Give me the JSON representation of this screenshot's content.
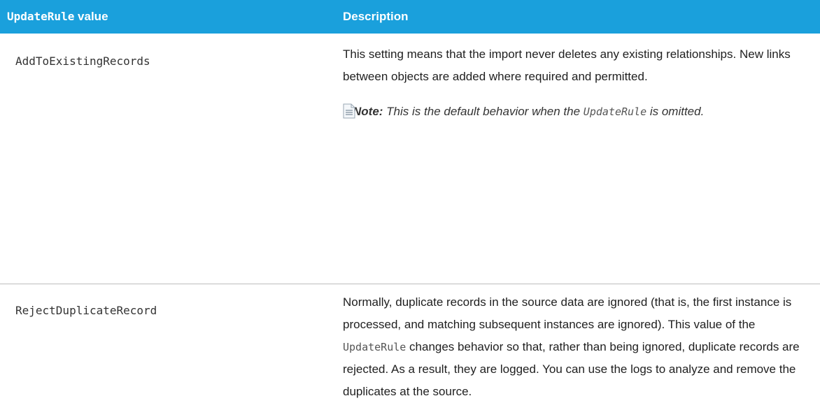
{
  "header": {
    "col1_code": "UpdateRule",
    "col1_suffix": " value",
    "col2": "Description"
  },
  "rows": [
    {
      "value": "AddToExistingRecords",
      "description": "This setting means that the import never deletes any existing relationships. New links between objects are added where required and permitted.",
      "note": {
        "label": "Note:",
        "text_before": " This is the default behavior when the ",
        "code": "UpdateRule",
        "text_after": " is omitted."
      }
    },
    {
      "value": "RejectDuplicateRecord",
      "description_before": "Normally, duplicate records in the source data are ignored (that is, the first instance is processed, and matching subsequent instances are ignored). This value of the ",
      "description_code": "UpdateRule",
      "description_after": " changes behavior so that, rather than being ignored, duplicate records are rejected. As a result, they are logged. You can use the logs to analyze and remove the duplicates at the source."
    }
  ],
  "icons": {
    "note": "note-icon"
  },
  "colors": {
    "header_bg": "#1aa0dc",
    "header_text": "#ffffff"
  }
}
